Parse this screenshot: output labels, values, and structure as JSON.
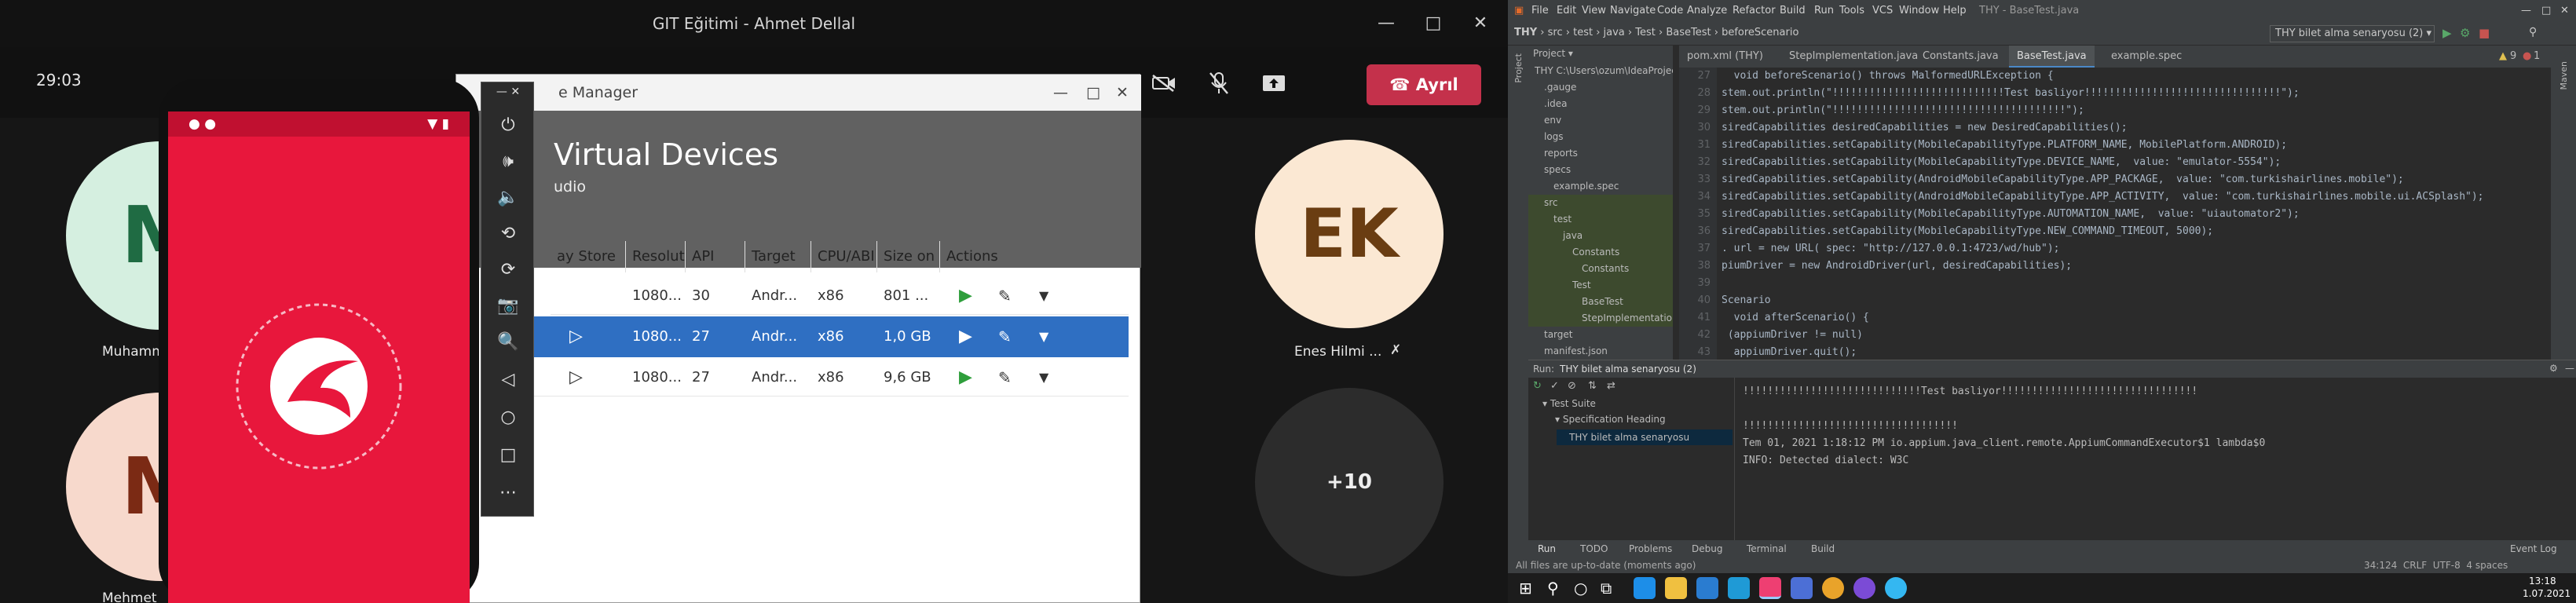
{
  "teams": {
    "title": "GIT Eğitimi - Ahmet Dellal",
    "timer": "29:03",
    "leave_label": "Ayrıl",
    "participants": [
      {
        "initials": "M",
        "name": "Muhamm",
        "color": "#1f6b43",
        "bg": "#d5efe0"
      },
      {
        "initials": "M",
        "name": "Mehmet",
        "color": "#7b2a14",
        "bg": "#f7d9cc"
      },
      {
        "initials": "EK",
        "name": "Enes Hilmi ...",
        "color": "#6a3d12",
        "bg": "#fbe8d3"
      }
    ],
    "overflow_count": "+10"
  },
  "device_manager": {
    "window_title": "e Manager",
    "heading": "Virtual Devices",
    "subheading": "udio",
    "columns": [
      "ay Store",
      "Resoluti...",
      "API",
      "Target",
      "CPU/ABI",
      "Size on ...",
      "Actions"
    ],
    "rows": [
      {
        "resolution": "1080...",
        "api": "30",
        "target": "Andr...",
        "cpu": "x86",
        "size": "801 ...",
        "selected": false
      },
      {
        "resolution": "1080...",
        "api": "27",
        "target": "Andr...",
        "cpu": "x86",
        "size": "1,0 GB",
        "selected": true
      },
      {
        "resolution": "1080...",
        "api": "27",
        "target": "Andr...",
        "cpu": "x86",
        "size": "9,6 GB",
        "selected": false
      }
    ]
  },
  "ide": {
    "menu": [
      "File",
      "Edit",
      "View",
      "Navigate",
      "Code",
      "Analyze",
      "Refactor",
      "Build",
      "Run",
      "Tools",
      "VCS",
      "Window",
      "Help"
    ],
    "window_title": "THY - BaseTest.java",
    "breadcrumb": [
      "THY",
      "src",
      "test",
      "java",
      "Test",
      "BaseTest",
      "beforeScenario"
    ],
    "run_config": "THY bilet alma senaryosu (2)",
    "project_label": "Project",
    "project_tree": [
      {
        "label": "THY C:\\Users\\ozum\\IdeaProjects\\THY",
        "indent": 0
      },
      {
        "label": ".gauge",
        "indent": 1
      },
      {
        "label": ".idea",
        "indent": 1
      },
      {
        "label": "env",
        "indent": 1
      },
      {
        "label": "logs",
        "indent": 1
      },
      {
        "label": "reports",
        "indent": 1
      },
      {
        "label": "specs",
        "indent": 1
      },
      {
        "label": "example.spec",
        "indent": 2
      },
      {
        "label": "src",
        "indent": 1
      },
      {
        "label": "test",
        "indent": 2
      },
      {
        "label": "java",
        "indent": 3
      },
      {
        "label": "Constants",
        "indent": 4
      },
      {
        "label": "Constants",
        "indent": 5
      },
      {
        "label": "Test",
        "indent": 4
      },
      {
        "label": "BaseTest",
        "indent": 5
      },
      {
        "label": "StepImplementation",
        "indent": 5
      },
      {
        "label": "target",
        "indent": 1
      },
      {
        "label": "manifest.json",
        "indent": 1
      }
    ],
    "tabs": [
      "pom.xml (THY)",
      "StepImplementation.java",
      "Constants.java",
      "BaseTest.java",
      "example.spec"
    ],
    "active_tab": "BaseTest.java",
    "line_numbers": [
      "27",
      "28",
      "29",
      "30",
      "31",
      "32",
      "33",
      "34",
      "35",
      "36",
      "37",
      "38",
      "39",
      "40",
      "41",
      "42",
      "43"
    ],
    "code_lines": [
      "  void beforeScenario() throws MalformedURLException {",
      "stem.out.println(\"!!!!!!!!!!!!!!!!!!!!!!!!!!!!Test basliyor!!!!!!!!!!!!!!!!!!!!!!!!!!!!!!!!\");",
      "stem.out.println(\"!!!!!!!!!!!!!!!!!!!!!!!!!!!!!!!!!!!!!!\");",
      "siredCapabilities desiredCapabilities = new DesiredCapabilities();",
      "siredCapabilities.setCapability(MobileCapabilityType.PLATFORM_NAME, MobilePlatform.ANDROID);",
      "siredCapabilities.setCapability(MobileCapabilityType.DEVICE_NAME,  value: \"emulator-5554\");",
      "siredCapabilities.setCapability(AndroidMobileCapabilityType.APP_PACKAGE,  value: \"com.turkishairlines.mobile\");",
      "siredCapabilities.setCapability(AndroidMobileCapabilityType.APP_ACTIVITY,  value: \"com.turkishairlines.mobile.ui.ACSplash\");",
      "siredCapabilities.setCapability(MobileCapabilityType.AUTOMATION_NAME,  value: \"uiautomator2\");",
      "siredCapabilities.setCapability(MobileCapabilityType.NEW_COMMAND_TIMEOUT, 5000);",
      ". url = new URL( spec: \"http://127.0.0.1:4723/wd/hub\");",
      "piumDriver = new AndroidDriver(url, desiredCapabilities);",
      "",
      "Scenario",
      "  void afterScenario() {",
      " (appiumDriver != null)",
      "  appiumDriver.quit();"
    ],
    "run_label": "Run:",
    "run_tab": "THY bilet alma senaryosu (2)",
    "run_tree": [
      "Test Suite",
      "Specification Heading",
      "THY bilet alma senaryosu"
    ],
    "console": [
      "!!!!!!!!!!!!!!!!!!!!!!!!!!!!!Test basliyor!!!!!!!!!!!!!!!!!!!!!!!!!!!!!!!!",
      "",
      "!!!!!!!!!!!!!!!!!!!!!!!!!!!!!!!!!!!",
      "Tem 01, 2021 1:18:12 PM io.appium.java_client.remote.AppiumCommandExecutor$1 lambda$0",
      "INFO: Detected dialect: W3C"
    ],
    "bottom_tabs": [
      "Run",
      "TODO",
      "Problems",
      "Debug",
      "Terminal",
      "Build"
    ],
    "event_log": "Event Log",
    "status_left": "All files are up-to-date (moments ago)",
    "status_right": "34:124  CRLF  UTF-8  4 spaces",
    "warnings": "9",
    "errors": "1",
    "clock_time": "13:18",
    "clock_date": "1.07.2021"
  }
}
